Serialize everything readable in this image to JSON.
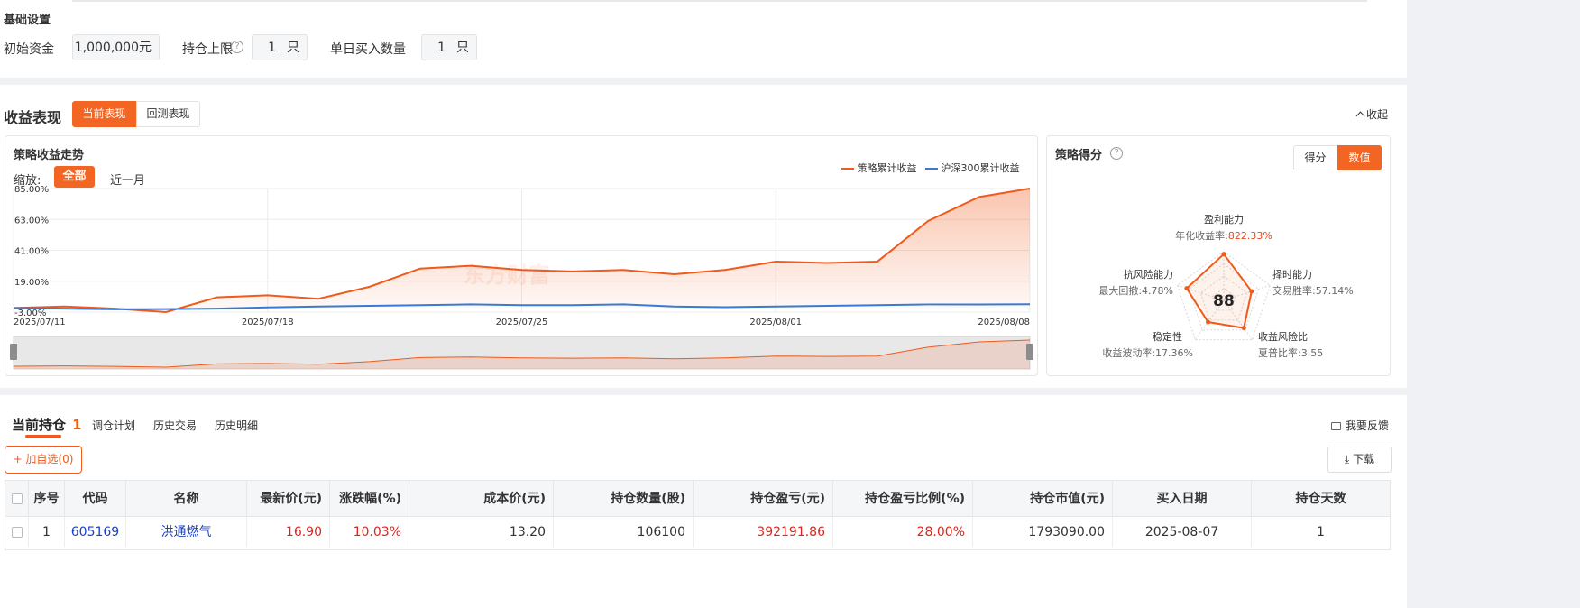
{
  "basic": {
    "title": "基础设置",
    "capital_label": "初始资金",
    "capital_value": "1,000,000",
    "capital_unit": "元",
    "limit_label": "持仓上限",
    "limit_value": "1",
    "limit_unit": "只",
    "daily_label": "单日买入数量",
    "daily_value": "1",
    "daily_unit": "只"
  },
  "perf": {
    "title": "收益表现",
    "tab_current": "当前表现",
    "tab_backtest": "回测表现",
    "collapse": "收起",
    "trend_title": "策略收益走势",
    "zoom_label": "缩放:",
    "zoom_all": "全部",
    "zoom_month": "近一月",
    "watermark": "东方财富",
    "score_title": "策略得分",
    "score_tab": "得分",
    "value_tab": "数值",
    "radar": {
      "score": "88",
      "labels": [
        {
          "name": "盈利能力",
          "metric": "年化收益率:",
          "value": "822.33%"
        },
        {
          "name": "择时能力",
          "metric": "交易胜率:",
          "value": "57.14%"
        },
        {
          "name": "收益风险比",
          "metric": "夏普比率:",
          "value": "3.55"
        },
        {
          "name": "稳定性",
          "metric": "收益波动率:",
          "value": "17.36%"
        },
        {
          "name": "抗风险能力",
          "metric": "最大回撤:",
          "value": "4.78%"
        }
      ],
      "scores": [
        0.95,
        0.6,
        0.7,
        0.55,
        0.8
      ]
    }
  },
  "chart_data": {
    "type": "area",
    "x": [
      "2025/07/11",
      "2025/07/14",
      "2025/07/15",
      "2025/07/16",
      "2025/07/17",
      "2025/07/18",
      "2025/07/21",
      "2025/07/22",
      "2025/07/23",
      "2025/07/24",
      "2025/07/25",
      "2025/07/28",
      "2025/07/29",
      "2025/07/30",
      "2025/07/31",
      "2025/08/01",
      "2025/08/04",
      "2025/08/05",
      "2025/08/06",
      "2025/08/07",
      "2025/08/08"
    ],
    "x_ticks": [
      "2025/07/11",
      "2025/07/18",
      "2025/07/25",
      "2025/08/01",
      "2025/08/08"
    ],
    "y_ticks": [
      "85.00%",
      "63.00%",
      "41.00%",
      "19.00%",
      "-3.00%"
    ],
    "ylim": [
      -3,
      85
    ],
    "series": [
      {
        "name": "策略累计收益",
        "color": "#f05a1a",
        "values": [
          0,
          1,
          -0.5,
          -3,
          7.5,
          9,
          6.5,
          15,
          28,
          30,
          27,
          26,
          27,
          24,
          27,
          33,
          32,
          33,
          62,
          79,
          85
        ]
      },
      {
        "name": "沪深300累计收益",
        "color": "#3a7ad5",
        "values": [
          0,
          -0.5,
          -1,
          -0.8,
          -0.5,
          0.4,
          1,
          1.5,
          2,
          2.5,
          2,
          2,
          2.5,
          1,
          0.5,
          1,
          1.5,
          2,
          2.5,
          2.5,
          2.6
        ]
      }
    ]
  },
  "holdings": {
    "tab_current": "当前持仓",
    "count": "1",
    "tab_plan": "调仓计划",
    "tab_trades": "历史交易",
    "tab_details": "历史明细",
    "feedback": "我要反馈",
    "add_watch": "+ 加自选(0)",
    "download": "下载",
    "headers": [
      "序号",
      "代码",
      "名称",
      "最新价(元)",
      "涨跌幅(%)",
      "成本价(元)",
      "持仓数量(股)",
      "持仓盈亏(元)",
      "持仓盈亏比例(%)",
      "持仓市值(元)",
      "买入日期",
      "持仓天数"
    ],
    "rows": [
      [
        "1",
        "605169",
        "洪通燃气",
        "16.90",
        "10.03%",
        "13.20",
        "106100",
        "392191.86",
        "28.00%",
        "1793090.00",
        "2025-08-07",
        "1"
      ]
    ]
  }
}
